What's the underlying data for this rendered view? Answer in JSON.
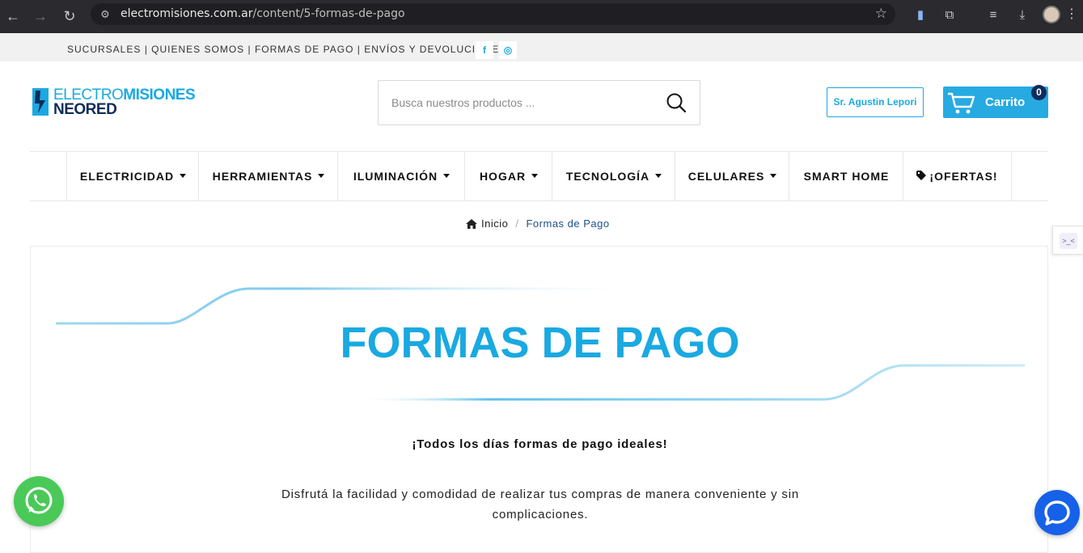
{
  "browser": {
    "url_domain": "electromisiones.com.ar",
    "url_path": "/content/5-formas-de-pago"
  },
  "topbar": {
    "links": "SUCURSALES | QUIENES SOMOS | FORMAS DE PAGO | ENVÍOS Y DEVOLUCIONES",
    "facebook": "f",
    "instagram": "◎"
  },
  "logo": {
    "line1_light": "ELECTRO",
    "line1_bold": "MISIONES",
    "line2": "NEORED"
  },
  "search": {
    "placeholder": "Busca nuestros productos ..."
  },
  "account": {
    "user_label": "Sr. Agustin Lepori",
    "cart_label": "Carrito",
    "cart_count": "0"
  },
  "nav": {
    "items": [
      {
        "label": "ELECTRICIDAD"
      },
      {
        "label": "HERRAMIENTAS"
      },
      {
        "label": "ILUMINACIÓN"
      },
      {
        "label": "HOGAR"
      },
      {
        "label": "TECNOLOGÍA"
      },
      {
        "label": "CELULARES"
      },
      {
        "label": "SMART HOME"
      },
      {
        "label": "¡OFERTAS!"
      }
    ]
  },
  "breadcrumb": {
    "home": "Inicio",
    "separator": "/",
    "current": "Formas de Pago"
  },
  "content": {
    "title": "FORMAS DE PAGO",
    "subheading": "¡Todos los días formas de pago ideales!",
    "paragraph": "Disfrutá la facilidad y comodidad de realizar tus compras de manera conveniente y sin complicaciones."
  },
  "widgets": {
    "side_widget_text": ">_<"
  },
  "colors": {
    "brand_blue": "#1aa9e1",
    "brand_navy": "#0e2c5a",
    "whatsapp": "#4ac959",
    "chat": "#1761e9"
  }
}
